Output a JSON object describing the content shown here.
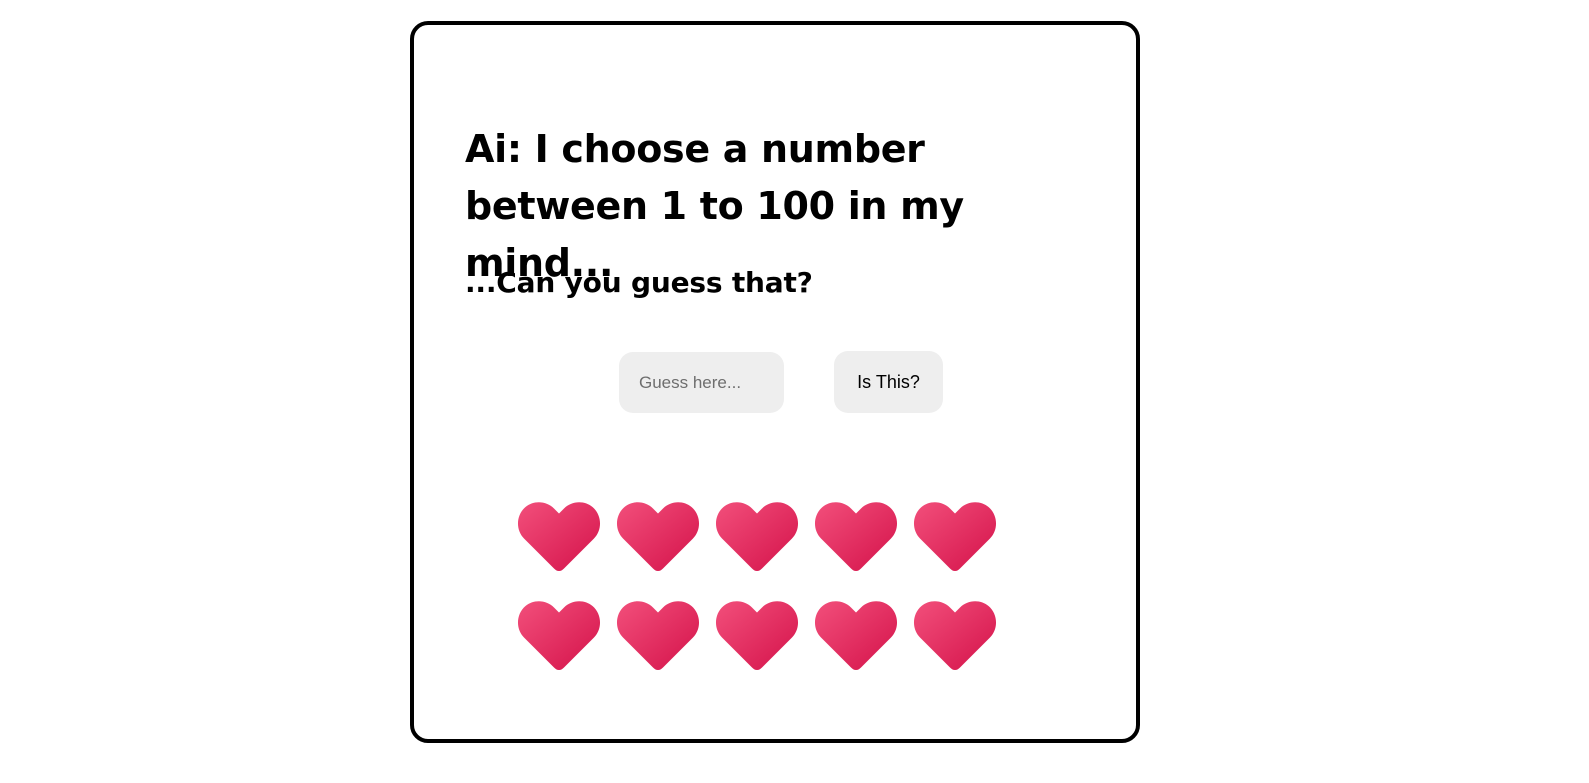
{
  "game": {
    "title": "Ai: I choose a number between 1 to 100 in my mind...",
    "subtitle": "...Can you guess that?",
    "guess_input": {
      "placeholder": "Guess here...",
      "value": ""
    },
    "guess_button_label": "Is This?",
    "lives": {
      "remaining": 10,
      "total": 10,
      "icon": "heart-icon",
      "gradient_light": "#f24f7b",
      "gradient_dark": "#d4124a"
    }
  }
}
